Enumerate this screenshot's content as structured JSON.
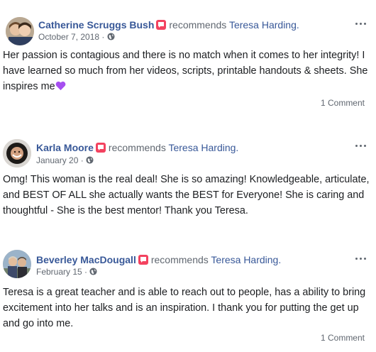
{
  "reviews": [
    {
      "author": "Catherine Scruggs Bush",
      "action": "recommends",
      "page": "Teresa Harding.",
      "date": "October 7, 2018 ·",
      "text": "Her passion is contagious and there is no match when it comes to her integrity! I have learned so much from her videos, scripts, printable handouts & sheets. She inspires me",
      "comments": "1 Comment"
    },
    {
      "author": "Karla Moore",
      "action": "recommends",
      "page": "Teresa Harding.",
      "date": "January 20 ·",
      "text": "Omg! This woman is the real deal! She is so amazing! Knowledgeable, articulate, and BEST OF ALL she actually wants the BEST for Everyone! She is caring and thoughtful - She is the best mentor! Thank you Teresa."
    },
    {
      "author": "Beverley MacDougall",
      "action": "recommends",
      "page": "Teresa Harding.",
      "date": "February 15 ·",
      "text": "Teresa is a great teacher and is able to reach out to people, has a ability to bring excitement into her talks and is an inspiration. I thank you for putting the get up and go into me.",
      "comments": "1 Comment"
    }
  ],
  "colors": {
    "link": "#385898",
    "secondary_text": "#606770",
    "badge": "#f3425f",
    "heart": "#a64ff0"
  }
}
